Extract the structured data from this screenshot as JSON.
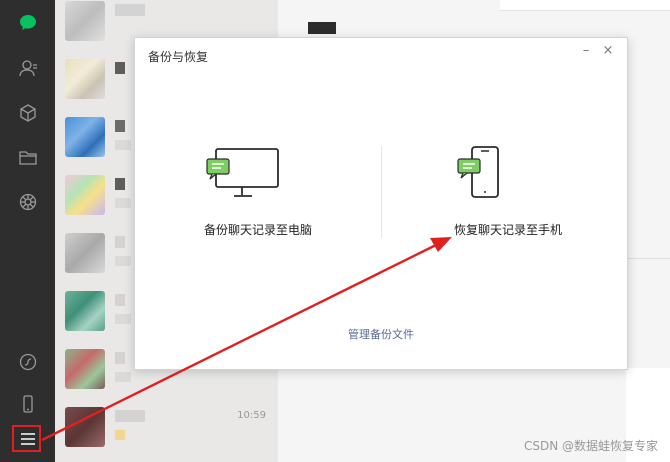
{
  "dialog": {
    "title": "备份与恢复",
    "minimize_label": "–",
    "close_label": "×",
    "backup_label": "备份聊天记录至电脑",
    "restore_label": "恢复聊天记录至手机",
    "manage_label": "管理备份文件"
  },
  "chat_list": {
    "last_time": "10:59"
  },
  "watermark": "CSDN @数据蛙恢复专家",
  "colors": {
    "sidebar": "#2e2e2e",
    "wechat_green": "#07c160",
    "link": "#576b95",
    "annotation_red": "#e02020"
  },
  "icons": [
    "chat-icon",
    "contacts-icon",
    "favorites-icon",
    "files-icon",
    "moments-icon",
    "mini-program-icon",
    "phone-icon",
    "menu-icon",
    "pc-icon",
    "phone-restore-icon"
  ]
}
